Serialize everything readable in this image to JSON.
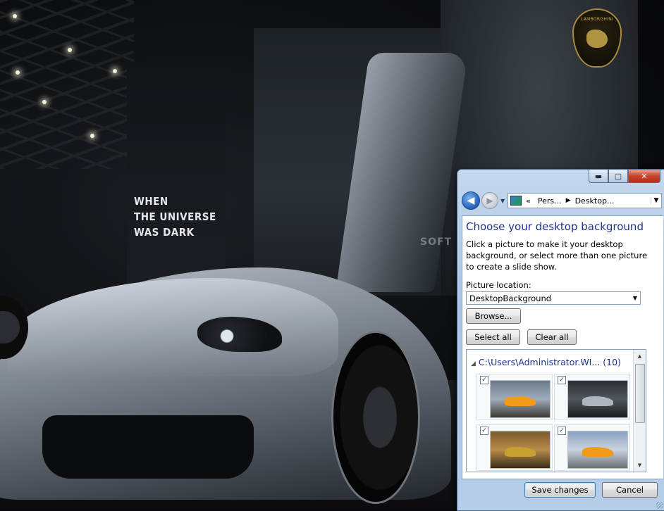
{
  "wallpaper": {
    "banner_text": "WHEN\nTHE UNIVERSE\nWAS DARK",
    "badge_text": "LAMBORGHINI",
    "watermark": "SOFT"
  },
  "window": {
    "caption": {
      "minimize": "▬",
      "maximize": "▢",
      "close": "✕"
    },
    "nav": {
      "back_glyph": "◀",
      "forward_glyph": "▶",
      "dropdown_glyph": "▼",
      "address_prefix": "«",
      "crumbs": [
        "Pers...",
        "Desktop..."
      ],
      "crumb_sep": "▶",
      "address_arrow": "▼"
    },
    "pane": {
      "title": "Choose your desktop background",
      "description": "Click a picture to make it your desktop background, or select more than one picture to create a slide show.",
      "picture_location_label": "Picture location:",
      "picture_location_value": "DesktopBackground",
      "browse_label": "Browse...",
      "select_all_label": "Select all",
      "clear_all_label": "Clear all",
      "folder_label": "C:\\Users\\Administrator.WI... (10)",
      "thumbnails": [
        {
          "checked": "✓"
        },
        {
          "checked": "✓"
        },
        {
          "checked": "✓"
        },
        {
          "checked": "✓"
        }
      ]
    },
    "footer": {
      "save_label": "Save changes",
      "cancel_label": "Cancel"
    }
  }
}
